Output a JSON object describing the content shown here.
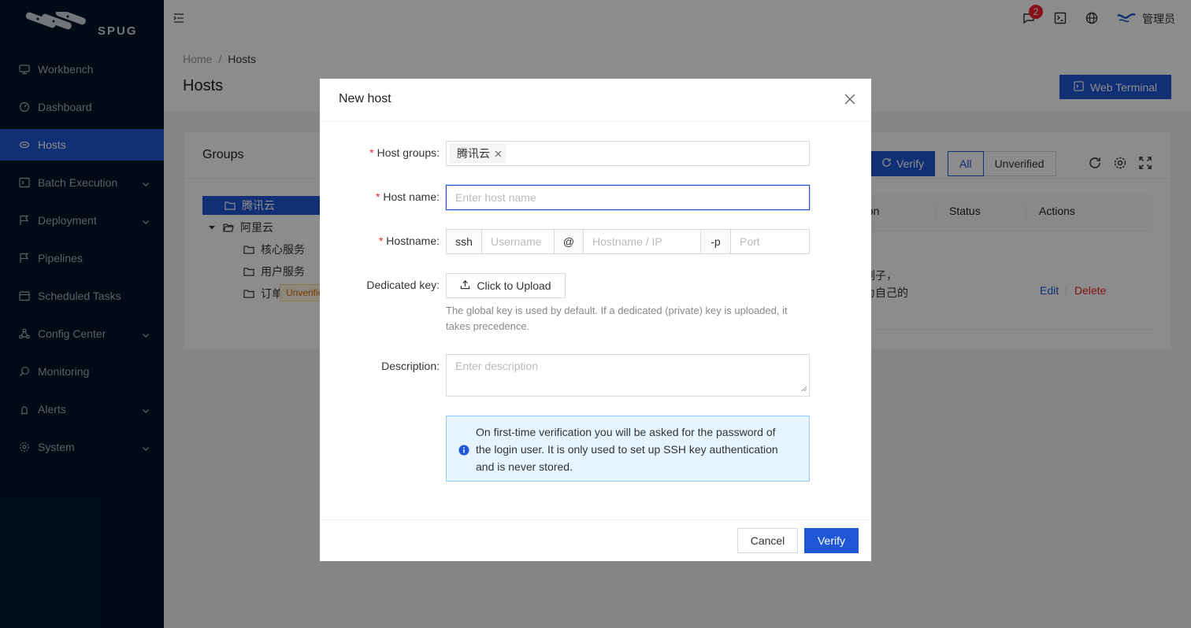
{
  "app": {
    "brand": "SPUG",
    "user_name": "管理员",
    "notification_count": "2"
  },
  "sidebar": {
    "items": [
      {
        "label": "Workbench",
        "icon": "monitor-icon",
        "has_children": false,
        "active": false
      },
      {
        "label": "Dashboard",
        "icon": "gauge-icon",
        "has_children": false,
        "active": false
      },
      {
        "label": "Hosts",
        "icon": "cloud-server-icon",
        "has_children": false,
        "active": true
      },
      {
        "label": "Batch Execution",
        "icon": "code-icon",
        "has_children": true,
        "active": false
      },
      {
        "label": "Deployment",
        "icon": "flag-icon",
        "has_children": true,
        "active": false
      },
      {
        "label": "Pipelines",
        "icon": "flag-icon",
        "has_children": false,
        "active": false
      },
      {
        "label": "Scheduled Tasks",
        "icon": "calendar-icon",
        "has_children": false,
        "active": false
      },
      {
        "label": "Config Center",
        "icon": "deployment-unit-icon",
        "has_children": true,
        "active": false
      },
      {
        "label": "Monitoring",
        "icon": "search-icon",
        "has_children": false,
        "active": false
      },
      {
        "label": "Alerts",
        "icon": "alert-icon",
        "has_children": true,
        "active": false
      },
      {
        "label": "System",
        "icon": "gear-icon",
        "has_children": true,
        "active": false
      }
    ]
  },
  "breadcrumb": {
    "home": "Home",
    "current": "Hosts"
  },
  "page": {
    "title": "Hosts",
    "web_terminal_label": "Web Terminal"
  },
  "groups": {
    "title": "Groups",
    "tree": [
      {
        "label": "腾讯云",
        "level": 0,
        "selected": true,
        "expandable": false
      },
      {
        "label": "阿里云",
        "level": 0,
        "selected": false,
        "expandable": true
      },
      {
        "label": "核心服务",
        "level": 1,
        "selected": false,
        "expandable": false
      },
      {
        "label": "用户服务",
        "level": 1,
        "selected": false,
        "expandable": false
      },
      {
        "label": "订单服务",
        "level": 1,
        "selected": false,
        "expandable": false
      }
    ]
  },
  "toolbar": {
    "verify_label": "Verify",
    "filter_all": "All",
    "filter_unverified": "Unverified"
  },
  "table": {
    "columns": {
      "description": "iption",
      "status": "Status",
      "actions": "Actions"
    },
    "row": {
      "desc_line1": "条例子，",
      "desc_line2": "这为自己的",
      "status": "Unverified",
      "edit": "Edit",
      "delete": "Delete"
    }
  },
  "modal": {
    "title": "New host",
    "host_groups_label": "Host groups",
    "host_groups_tag": "腾讯云",
    "host_name_label": "Host name",
    "host_name_placeholder": "Enter host name",
    "hostname_label": "Hostname",
    "ssh_addon": "ssh",
    "username_placeholder": "Username",
    "at_addon": "@",
    "host_ip_placeholder": "Hostname / IP",
    "port_addon": "-p",
    "port_placeholder": "Port",
    "dedicated_key_label": "Dedicated key",
    "upload_label": "Click to Upload",
    "key_help_line1": "The global key is used by default. If a dedicated (private) key is uploaded, it",
    "key_help_line2": "takes precedence.",
    "description_label": "Description",
    "description_placeholder": "Enter description",
    "alert_line1": "On first-time verification you will be asked for the password of",
    "alert_line2": "the login user. It is only used to set up SSH key authentication",
    "alert_line3": "and is never stored.",
    "cancel_label": "Cancel",
    "verify_label": "Verify"
  },
  "colors": {
    "primary": "#1f57d6",
    "sidebar_bg": "#001529",
    "required": "#f5222d",
    "delete": "#f5222d",
    "warn_tag": "#d46b08"
  }
}
